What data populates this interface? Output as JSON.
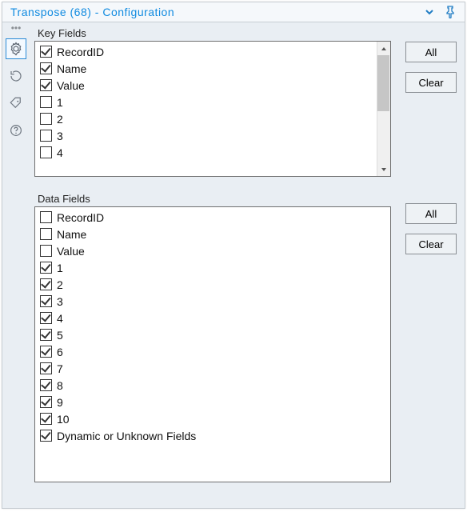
{
  "header": {
    "title": "Transpose (68) - Configuration"
  },
  "sections": {
    "keyfields_label": "Key Fields",
    "datafields_label": "Data Fields"
  },
  "buttons": {
    "all": "All",
    "clear": "Clear"
  },
  "keyfields": {
    "items": [
      {
        "label": "RecordID",
        "checked": true
      },
      {
        "label": "Name",
        "checked": true
      },
      {
        "label": "Value",
        "checked": true
      },
      {
        "label": "1",
        "checked": false
      },
      {
        "label": "2",
        "checked": false
      },
      {
        "label": "3",
        "checked": false
      },
      {
        "label": "4",
        "checked": false
      }
    ]
  },
  "datafields": {
    "items": [
      {
        "label": "RecordID",
        "checked": false
      },
      {
        "label": "Name",
        "checked": false
      },
      {
        "label": "Value",
        "checked": false
      },
      {
        "label": "1",
        "checked": true
      },
      {
        "label": "2",
        "checked": true
      },
      {
        "label": "3",
        "checked": true
      },
      {
        "label": "4",
        "checked": true
      },
      {
        "label": "5",
        "checked": true
      },
      {
        "label": "6",
        "checked": true
      },
      {
        "label": "7",
        "checked": true
      },
      {
        "label": "8",
        "checked": true
      },
      {
        "label": "9",
        "checked": true
      },
      {
        "label": "10",
        "checked": true
      },
      {
        "label": "Dynamic or Unknown Fields",
        "checked": true
      }
    ]
  }
}
